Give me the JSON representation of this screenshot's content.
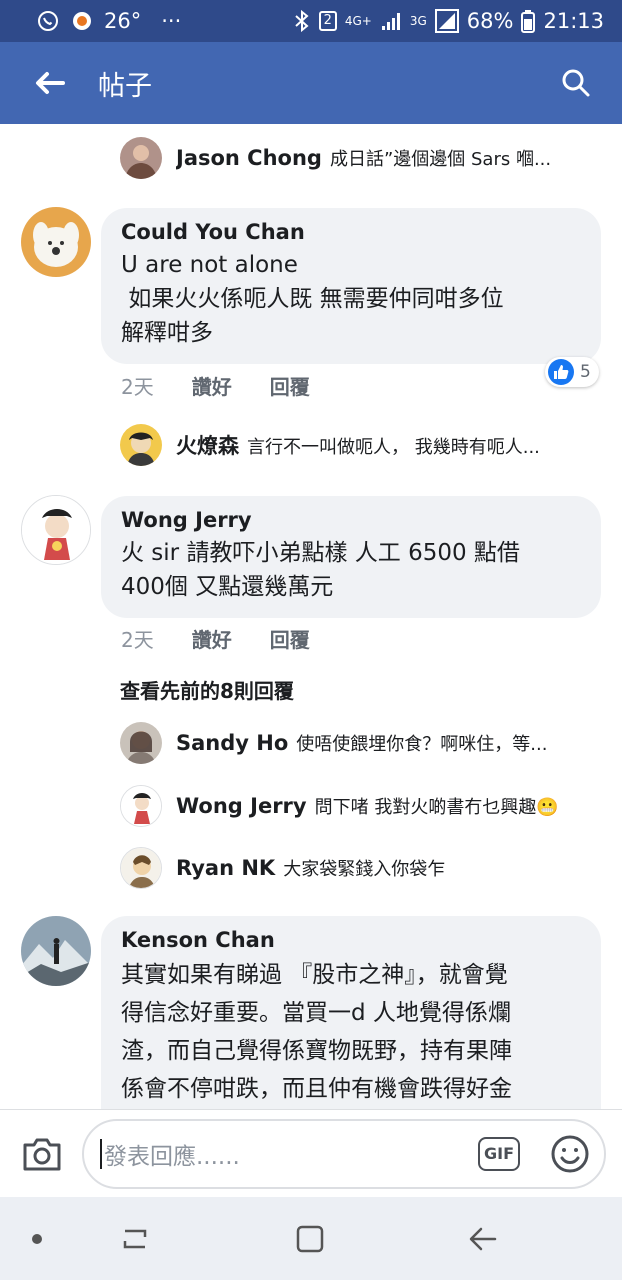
{
  "status_bar": {
    "temperature": "26°",
    "more": "···",
    "sim_badge": "2",
    "network_4g": "4G+",
    "network_3g": "3G",
    "battery": "68%",
    "time": "21:13"
  },
  "app_bar": {
    "title": "帖子",
    "back_icon": "arrow-left-icon",
    "search_icon": "search-icon"
  },
  "threads": [
    {
      "type": "reply-preview",
      "name": "Jason Chong",
      "text": "成日話”邊個邊個 Sars 嗰..."
    },
    {
      "type": "comment",
      "name": "Could You Chan",
      "text": "U are not alone\n 如果火火係呃人既 無需要仲同咁多位\n解釋咁多",
      "time": "2天",
      "like_label": "讚好",
      "reply_label": "回覆",
      "like_count": "5"
    },
    {
      "type": "reply-preview",
      "name": "火燎森",
      "text": "言行不一叫做呃人， 我幾時有呃人..."
    },
    {
      "type": "comment",
      "name": "Wong Jerry",
      "text": "火 sir 請教吓小弟點樣 人工 6500 點借\n400個 又點還幾萬元",
      "time": "2天",
      "like_label": "讚好",
      "reply_label": "回覆"
    }
  ],
  "view_previous": "查看先前的8則回覆",
  "replies": [
    {
      "name": "Sandy Ho",
      "text": "使唔使餵埋你食？啊咪住，等..."
    },
    {
      "name": "Wong Jerry",
      "text": "問下啫 我對火啲書冇乜興趣😬"
    },
    {
      "name": "Ryan NK",
      "text": "大家袋緊錢入你袋乍"
    }
  ],
  "last_comment": {
    "name": "Kenson Chan",
    "text": "其實如果有睇過 『股市之神』，就會覺\n得信念好重要。當買一d 人地覺得係爛\n渣，而自己覺得係寶物既野，持有果陣\n係會不停咁跌，而且仲有機會跌得好金"
  },
  "composer": {
    "placeholder": "發表回應......",
    "gif_label": "GIF"
  },
  "colors": {
    "app_bar": "#4267b2",
    "status_bar": "#2f4a8a",
    "bubble": "#f0f2f5",
    "like_blue": "#1877f2"
  }
}
